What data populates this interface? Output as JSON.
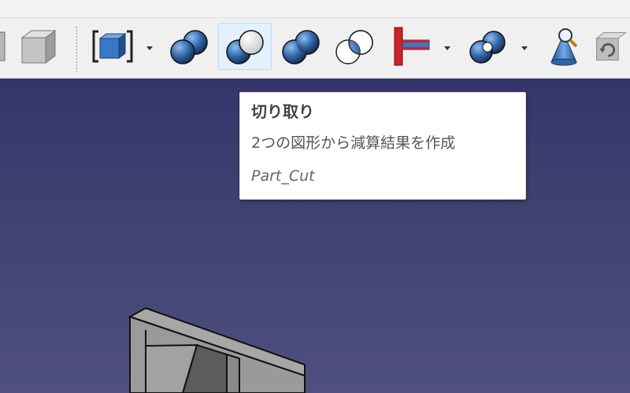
{
  "toolbar": {
    "buttons": [
      {
        "id": "box",
        "icon": "gray-box-icon"
      },
      {
        "id": "primitives",
        "icon": "blue-cube-bracket-icon",
        "has_dropdown": true
      },
      {
        "id": "boolean",
        "icon": "two-blue-spheres-icon"
      },
      {
        "id": "cut",
        "icon": "cut-spheres-icon",
        "hovered": true
      },
      {
        "id": "fuse",
        "icon": "fuse-spheres-icon"
      },
      {
        "id": "common",
        "icon": "common-spheres-icon"
      },
      {
        "id": "join",
        "icon": "red-t-join-icon",
        "has_dropdown": true
      },
      {
        "id": "split",
        "icon": "split-spheres-icon",
        "has_dropdown": true
      },
      {
        "id": "check-geometry",
        "icon": "cone-magnifier-icon"
      },
      {
        "id": "refresh",
        "icon": "refresh-box-icon"
      }
    ]
  },
  "tooltip": {
    "title": "切り取り",
    "description": "2つの図形から減算結果を作成",
    "command": "Part_Cut"
  },
  "colors": {
    "toolbar_bg": "#f0f0f0",
    "viewport_top": "#34366b",
    "viewport_bottom": "#504f80",
    "hover_bg": "#e4f1fc",
    "part_blue": "#2f64a6",
    "part_red": "#d0202a",
    "model_gray": "#9a9a9a"
  }
}
